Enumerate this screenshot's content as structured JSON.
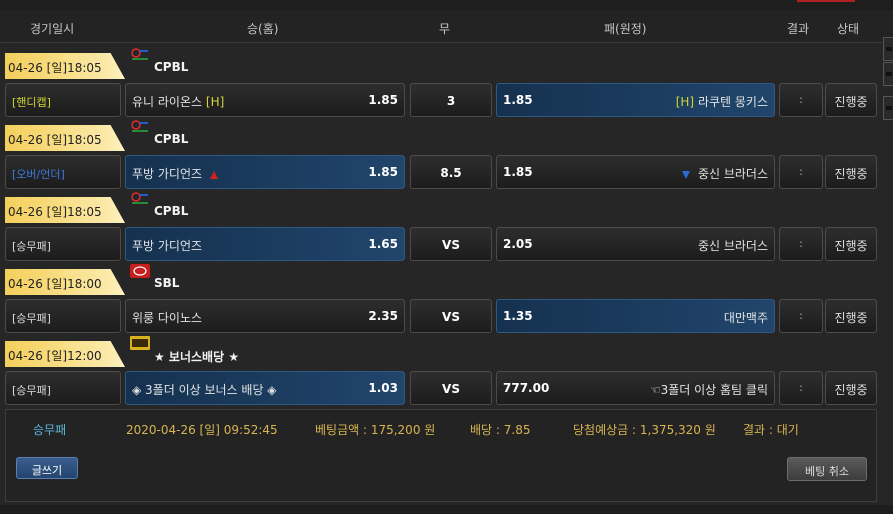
{
  "header": {
    "date": "경기일시",
    "home": "승(홈)",
    "draw": "무",
    "away": "패(원정)",
    "result": "결과",
    "status": "상태"
  },
  "colors": {
    "time_tag": "#f4cf5a",
    "selected_blue": "#1d3f63",
    "handicap_label": "#d4d438",
    "overunder_label": "#3a7adf",
    "summary_accent": "#58b7d8",
    "summary_gold": "#d8b451"
  },
  "games": [
    {
      "time": "04-26 [일]18:05",
      "league": "CPBL",
      "league_icon": "cpbl-logo",
      "bet_type": "[핸디캡]",
      "home_team": "유니 라이온스",
      "home_mark": "[H]",
      "home_odds": "1.85",
      "draw": "3",
      "away_odds": "1.85",
      "away_mark": "[H]",
      "away_team": "라쿠텐 몽키스",
      "result": ":",
      "status": "진행중",
      "selected": "away"
    },
    {
      "time": "04-26 [일]18:05",
      "league": "CPBL",
      "league_icon": "cpbl-logo",
      "bet_type": "[오버/언더]",
      "home_team": "푸방 가디언즈",
      "home_odds": "1.85",
      "draw": "8.5",
      "away_odds": "1.85",
      "away_team": "중신 브라더스",
      "result": ":",
      "status": "진행중",
      "selected": "home"
    },
    {
      "time": "04-26 [일]18:05",
      "league": "CPBL",
      "league_icon": "cpbl-logo",
      "bet_type": "[승무패]",
      "home_team": "푸방 가디언즈",
      "home_odds": "1.65",
      "draw": "VS",
      "away_odds": "2.05",
      "away_team": "중신 브라더스",
      "result": ":",
      "status": "진행중",
      "selected": "home"
    },
    {
      "time": "04-26 [일]18:00",
      "league": "SBL",
      "league_icon": "sbl-logo",
      "bet_type": "[승무패]",
      "home_team": "위룽 다이노스",
      "home_odds": "2.35",
      "draw": "VS",
      "away_odds": "1.35",
      "away_team": "대만맥주",
      "result": ":",
      "status": "진행중",
      "selected": "away"
    },
    {
      "time": "04-26 [일]12:00",
      "league": "★ 보너스배당 ★",
      "league_icon": "bonus-logo",
      "bet_type": "[승무패]",
      "home_team": "◈ 3폴더 이상 보너스 배당 ◈",
      "home_odds": "1.03",
      "draw": "VS",
      "away_odds": "777.00",
      "away_team": "☜3폴더 이상 홈팀 클릭",
      "result": ":",
      "status": "진행중",
      "selected": "home"
    }
  ],
  "summary": {
    "type": "승무패",
    "datetime": "2020-04-26 [일] 09:52:45",
    "bet_amount": "베팅금액 : 175,200 원",
    "odds": "배당 : 7.85",
    "expected": "당첨예상금 : 1,375,320 원",
    "result": "결과 : 대기",
    "write_button": "글쓰기",
    "cancel_button": "베팅 취소"
  }
}
